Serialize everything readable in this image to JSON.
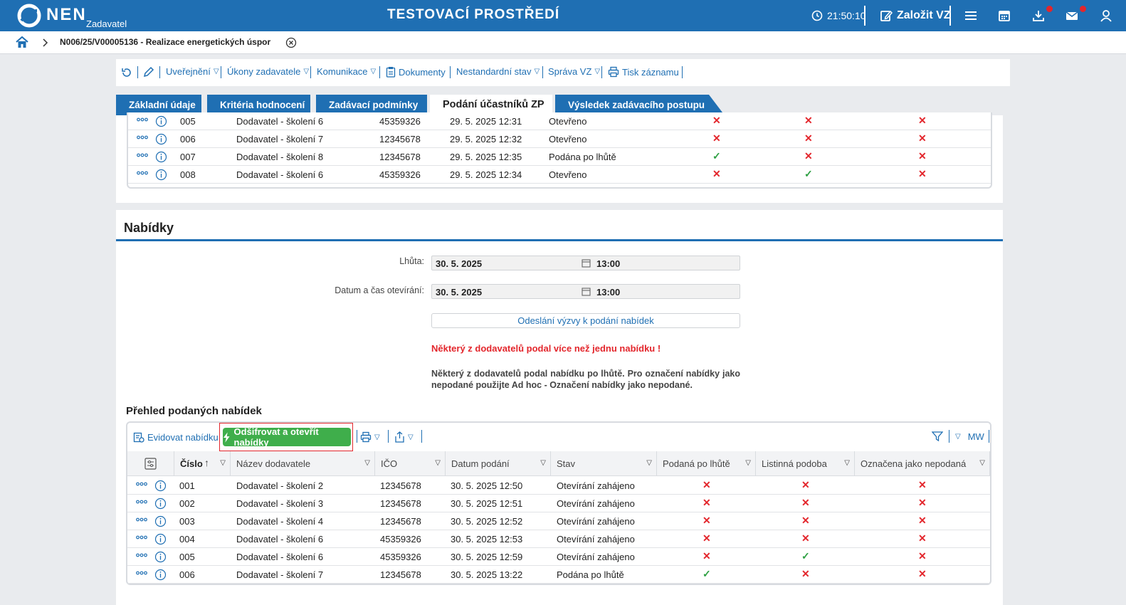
{
  "header": {
    "logo_text": "NEN",
    "logo_sub": "Zadavatel",
    "env_title": "TESTOVACÍ PROSTŘEDÍ",
    "clock": "21:50:10",
    "new_vz": "Založit VZ",
    "accent": "#1f6fb3"
  },
  "breadcrumb": {
    "title": "N006/25/V00005136 - Realizace energetických úspor"
  },
  "toolbar": {
    "items": [
      "Uveřejnění",
      "Úkony zadavatele",
      "Komunikace",
      "Dokumenty",
      "Nestandardní stav",
      "Správa VZ",
      "Tisk záznamu"
    ]
  },
  "tabs": [
    "Základní údaje",
    "Kritéria hodnocení",
    "Zadávací podmínky",
    "Podání účastníků ZP",
    "Výsledek zadávacího postupu"
  ],
  "upper_rows": [
    {
      "num": "005",
      "name": "Dodavatel - školení 6",
      "ico": "45359326",
      "date": "29. 5. 2025 12:31",
      "state": "Otevřeno",
      "late": false,
      "paper": false,
      "unsubmitted": false
    },
    {
      "num": "006",
      "name": "Dodavatel - školení 7",
      "ico": "12345678",
      "date": "29. 5. 2025 12:32",
      "state": "Otevřeno",
      "late": false,
      "paper": false,
      "unsubmitted": false
    },
    {
      "num": "007",
      "name": "Dodavatel - školení 8",
      "ico": "12345678",
      "date": "29. 5. 2025 12:35",
      "state": "Podána po lhůtě",
      "late": true,
      "paper": false,
      "unsubmitted": false
    },
    {
      "num": "008",
      "name": "Dodavatel - školení 6",
      "ico": "45359326",
      "date": "29. 5. 2025 12:34",
      "state": "Otevřeno",
      "late": false,
      "paper": true,
      "unsubmitted": false
    }
  ],
  "nabidky": {
    "title": "Nabídky",
    "lhuta_label": "Lhůta:",
    "lhuta_date": "30. 5. 2025",
    "lhuta_time": "13:00",
    "open_label": "Datum a čas otevírání:",
    "open_date": "30. 5. 2025",
    "open_time": "13:00",
    "send_button": "Odeslání výzvy k podání nabídek",
    "warning": "Některý z dodavatelů podal více než jednu nabídku !",
    "note": "Některý z dodavatelů podal nabídku po lhůtě. Pro označení nabídky jako nepodané použijte Ad hoc - Označení nabídky jako nepodané."
  },
  "overview": {
    "title": "Přehled podaných nabídek",
    "evidovat": "Evidovat nabídku",
    "decrypt": "Odšifrovat a otevřít nabídky",
    "mw": "MW",
    "columns": [
      "Číslo",
      "Název dodavatele",
      "IČO",
      "Datum podání",
      "Stav",
      "Podaná po lhůtě",
      "Listinná podoba",
      "Označena jako nepodaná"
    ],
    "rows": [
      {
        "num": "001",
        "name": "Dodavatel - školení 2",
        "ico": "12345678",
        "date": "30. 5. 2025 12:50",
        "state": "Otevírání zahájeno",
        "late": false,
        "paper": false,
        "unsubmitted": false
      },
      {
        "num": "002",
        "name": "Dodavatel - školení 3",
        "ico": "12345678",
        "date": "30. 5. 2025 12:51",
        "state": "Otevírání zahájeno",
        "late": false,
        "paper": false,
        "unsubmitted": false
      },
      {
        "num": "003",
        "name": "Dodavatel - školení 4",
        "ico": "12345678",
        "date": "30. 5. 2025 12:52",
        "state": "Otevírání zahájeno",
        "late": false,
        "paper": false,
        "unsubmitted": false
      },
      {
        "num": "004",
        "name": "Dodavatel - školení 6",
        "ico": "45359326",
        "date": "30. 5. 2025 12:53",
        "state": "Otevírání zahájeno",
        "late": false,
        "paper": false,
        "unsubmitted": false
      },
      {
        "num": "005",
        "name": "Dodavatel - školení 6",
        "ico": "45359326",
        "date": "30. 5. 2025 12:59",
        "state": "Otevírání zahájeno",
        "late": false,
        "paper": true,
        "unsubmitted": false
      },
      {
        "num": "006",
        "name": "Dodavatel - školení 7",
        "ico": "12345678",
        "date": "30. 5. 2025 13:22",
        "state": "Podána po lhůtě",
        "late": true,
        "paper": false,
        "unsubmitted": false
      }
    ]
  }
}
